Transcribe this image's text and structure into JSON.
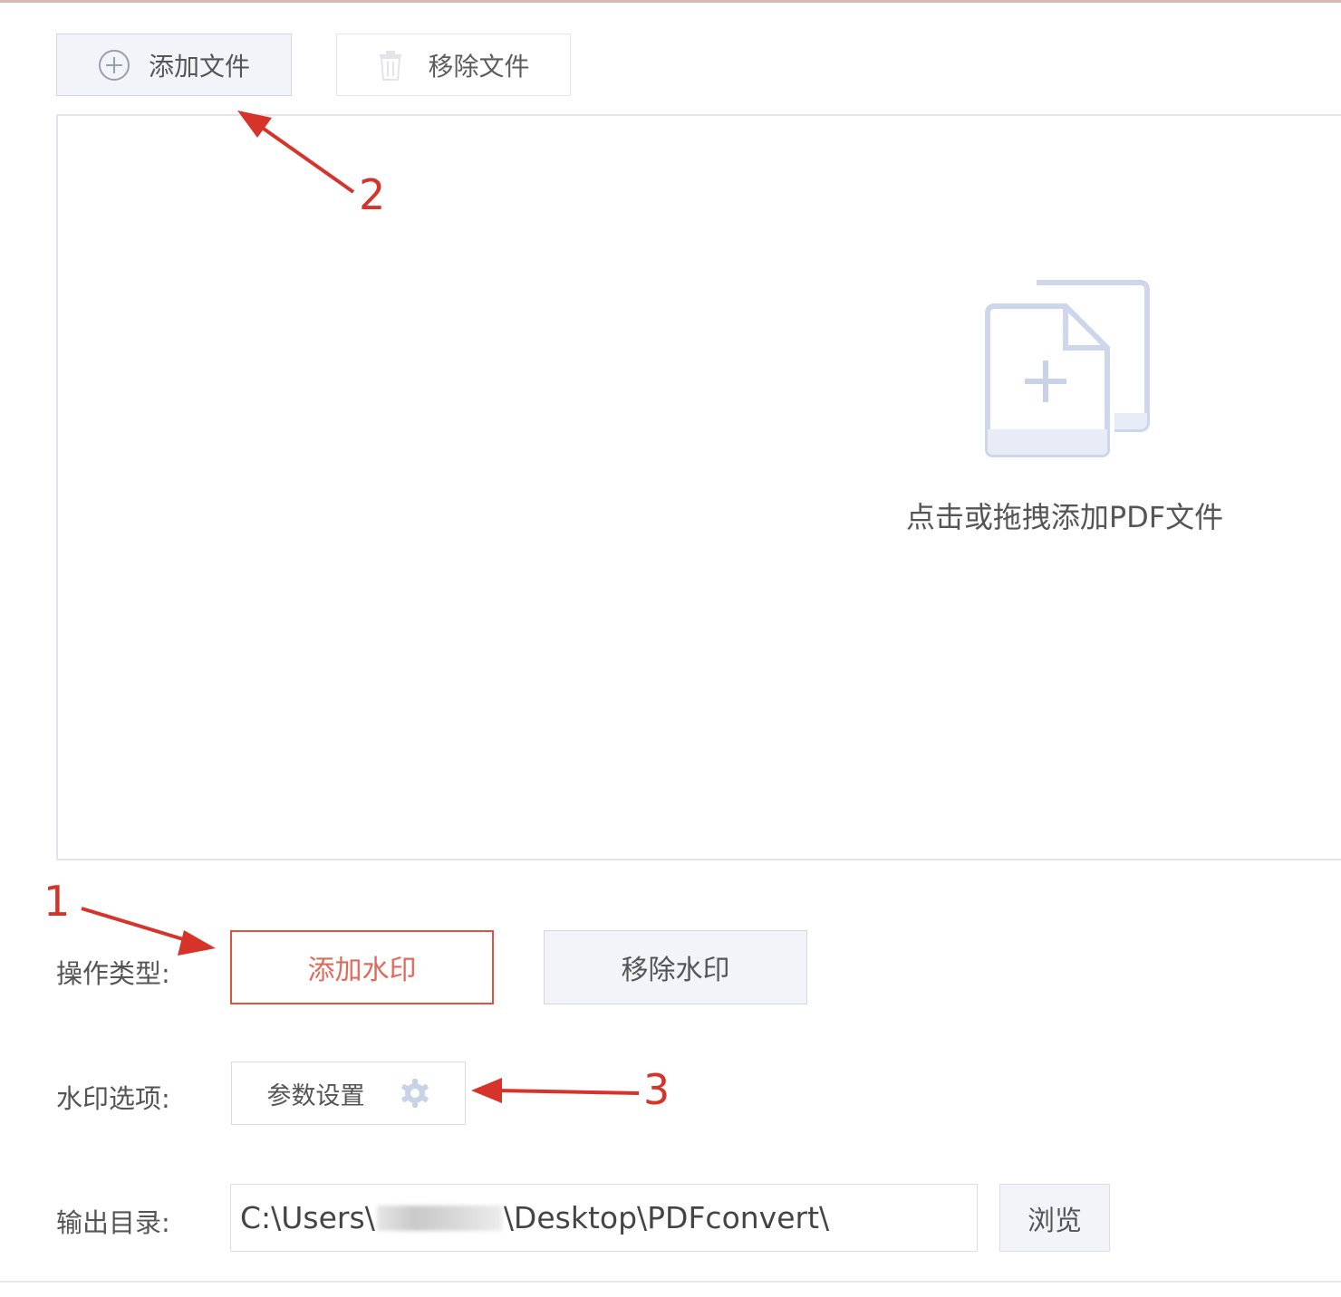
{
  "toolbar": {
    "add_file_label": "添加文件",
    "remove_file_label": "移除文件"
  },
  "drop_area": {
    "hint": "点击或拖拽添加PDF文件"
  },
  "operation": {
    "label": "操作类型:",
    "add_watermark": "添加水印",
    "remove_watermark": "移除水印",
    "selected": "添加水印"
  },
  "watermark_options": {
    "label": "水印选项:",
    "params_button": "参数设置"
  },
  "output": {
    "label": "输出目录:",
    "path_prefix": "C:\\Users\\",
    "path_suffix": "\\Desktop\\PDFconvert\\",
    "browse_label": "浏览"
  },
  "annotations": {
    "step1": "1",
    "step2": "2",
    "step3": "3",
    "color": "#d6332b"
  },
  "colors": {
    "accent": "#e0533f",
    "button_bg": "#f2f4f9",
    "border": "#d2d6de",
    "icon": "#c9d3e8"
  }
}
